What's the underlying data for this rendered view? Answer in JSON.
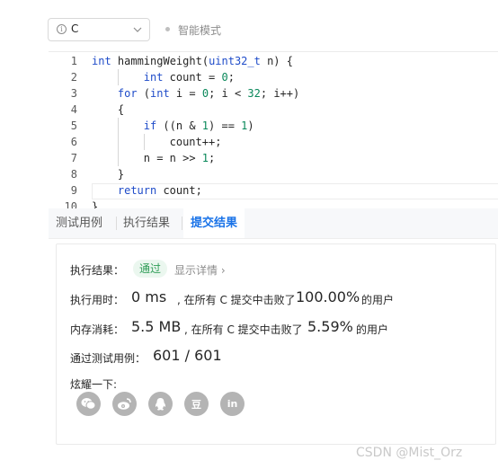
{
  "toolbar": {
    "language": "C",
    "mode_label": "智能模式"
  },
  "editor": {
    "lines": [
      {
        "n": "1",
        "indent": 0,
        "tokens": [
          [
            "ty",
            "int"
          ],
          [
            "fn",
            " hammingWeight("
          ],
          [
            "ty",
            "uint32_t"
          ],
          [
            "fn",
            " n) {"
          ]
        ]
      },
      {
        "n": "2",
        "indent": 2,
        "tokens": [
          [
            "ty",
            "int"
          ],
          [
            "fn",
            " count = "
          ],
          [
            "nm",
            "0"
          ],
          [
            "fn",
            ";"
          ]
        ]
      },
      {
        "n": "3",
        "indent": 1,
        "tokens": [
          [
            "kw",
            "for"
          ],
          [
            "fn",
            " ("
          ],
          [
            "ty",
            "int"
          ],
          [
            "fn",
            " i = "
          ],
          [
            "nm",
            "0"
          ],
          [
            "fn",
            "; i < "
          ],
          [
            "nm",
            "32"
          ],
          [
            "fn",
            "; i++)"
          ]
        ]
      },
      {
        "n": "4",
        "indent": 1,
        "tokens": [
          [
            "fn",
            "{"
          ]
        ]
      },
      {
        "n": "5",
        "indent": 2,
        "tokens": [
          [
            "kw",
            "if"
          ],
          [
            "fn",
            " ((n & "
          ],
          [
            "nm",
            "1"
          ],
          [
            "fn",
            ") == "
          ],
          [
            "nm",
            "1"
          ],
          [
            "fn",
            ")"
          ]
        ]
      },
      {
        "n": "6",
        "indent": 3,
        "tokens": [
          [
            "fn",
            "count++;"
          ]
        ]
      },
      {
        "n": "7",
        "indent": 2,
        "tokens": [
          [
            "fn",
            "n = n >> "
          ],
          [
            "nm",
            "1"
          ],
          [
            "fn",
            ";"
          ]
        ]
      },
      {
        "n": "8",
        "indent": 1,
        "tokens": [
          [
            "fn",
            "}"
          ]
        ]
      },
      {
        "n": "9",
        "indent": 1,
        "tokens": [
          [
            "kw",
            "return"
          ],
          [
            "fn",
            " count;"
          ]
        ]
      },
      {
        "n": "10",
        "indent": 0,
        "tokens": [
          [
            "fn",
            "}"
          ]
        ]
      }
    ]
  },
  "tabs": [
    {
      "label": "测试用例",
      "active": false
    },
    {
      "label": "执行结果",
      "active": false
    },
    {
      "label": "提交结果",
      "active": true
    }
  ],
  "result": {
    "status_label": "执行结果：",
    "status_value": "通过",
    "detail_link": "显示详情 ›",
    "time_label": "执行用时：",
    "time_value": "0 ms",
    "time_mid": ", 在所有 C 提交中击败了",
    "time_pct": "100.00%",
    "users_suffix": "的用户",
    "mem_label": "内存消耗：",
    "mem_value": "5.5 MB",
    "mem_mid": ", 在所有 C 提交中击败了",
    "mem_pct": "5.59%",
    "tests_label": "通过测试用例：",
    "tests_value": "601 / 601",
    "share_label": "炫耀一下:"
  },
  "share_icons": [
    "wechat-icon",
    "weibo-icon",
    "qq-icon",
    "douban-icon",
    "linkedin-icon"
  ],
  "share_glyphs": [
    "",
    "",
    "",
    "豆",
    "in"
  ],
  "watermark": "CSDN @Mist_Orz",
  "colors": {
    "accent": "#1a73e8",
    "pass": "#2f9d57",
    "pass_bg": "#ebf7ef",
    "keyword": "#1f4cc9",
    "number": "#09885a"
  }
}
